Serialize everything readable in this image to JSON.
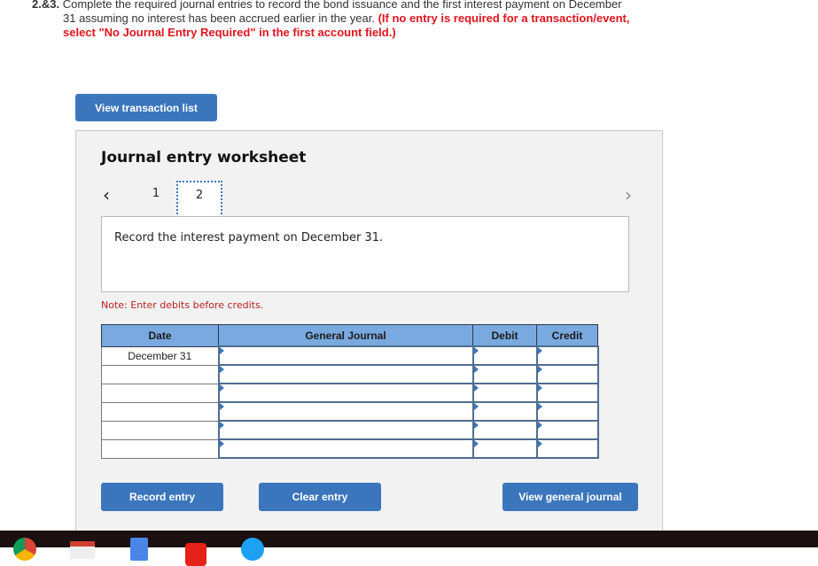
{
  "question": {
    "number": "2.&3.",
    "text_line1": "Complete the required journal entries to record the bond issuance and the first interest payment on December",
    "text_line2": "31 assuming no interest has been accrued earlier in the year.",
    "instruction_red": "(If no entry is required for a transaction/event,",
    "instruction_red_line3": "select \"No Journal Entry Required\" in the first account field.)"
  },
  "buttons": {
    "view_transaction_list": "View transaction list",
    "record_entry": "Record entry",
    "clear_entry": "Clear entry",
    "view_general_journal": "View general journal"
  },
  "worksheet": {
    "title": "Journal entry worksheet",
    "prev_icon": "‹",
    "next_icon": "›",
    "tabs": [
      {
        "label": "1",
        "active": false
      },
      {
        "label": "2",
        "active": true
      }
    ],
    "description": "Record the interest payment on December 31.",
    "note": "Note: Enter debits before credits."
  },
  "table": {
    "headers": [
      "Date",
      "General Journal",
      "Debit",
      "Credit"
    ],
    "rows": [
      {
        "date": "December 31",
        "account": "",
        "debit": "",
        "credit": ""
      },
      {
        "date": "",
        "account": "",
        "debit": "",
        "credit": ""
      },
      {
        "date": "",
        "account": "",
        "debit": "",
        "credit": ""
      },
      {
        "date": "",
        "account": "",
        "debit": "",
        "credit": ""
      },
      {
        "date": "",
        "account": "",
        "debit": "",
        "credit": ""
      },
      {
        "date": "",
        "account": "",
        "debit": "",
        "credit": ""
      }
    ]
  },
  "taskbar": {
    "icons": [
      "chrome-icon",
      "gmail-icon",
      "docs-icon",
      "youtube-icon",
      "app-icon"
    ]
  },
  "colors": {
    "accent": "#3b76bc",
    "header_blue": "#7aa9e0",
    "instruction_red": "#e0141e",
    "note_red": "#b52424"
  }
}
